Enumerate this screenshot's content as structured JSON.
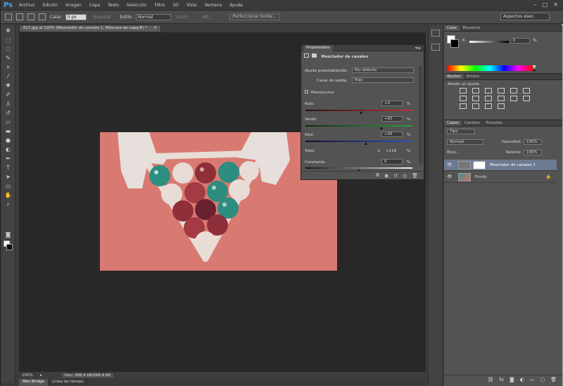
{
  "app": {
    "logo": "Ps"
  },
  "menu": [
    "Archivo",
    "Edición",
    "Imagen",
    "Capa",
    "Texto",
    "Selección",
    "Filtro",
    "3D",
    "Vista",
    "Ventana",
    "Ayuda"
  ],
  "window_controls": [
    "–",
    "□",
    "✕"
  ],
  "options": {
    "feather_label": "Calar:",
    "feather_value": "0 px",
    "antialias_label": "Suavizar",
    "style_label": "Estilo:",
    "style_value": "Normal",
    "width_label": "Anch.:",
    "height_label": "Alt.:",
    "refine_button": "Perfeccionar borde...",
    "workspace": "Aspectos esen."
  },
  "document": {
    "tab_title": "617.jpg al 100% (Mezclador de canales 1, Máscara de capa/8) *",
    "zoom": "100%",
    "doc_info": "Doc: 388,4 kB/388,4 kB"
  },
  "bottom_tabs": [
    "Mini Bridge",
    "Línea de tiempo"
  ],
  "properties": {
    "tab": "Propiedades",
    "title": "Mezclador de canales",
    "preset_label": "Ajuste preestablecido:",
    "preset_value": "Por defecto",
    "channel_label": "Canal de salida:",
    "channel_value": "Rojo",
    "mono_label": "Monocromo",
    "rows": [
      {
        "label": "Rojo:",
        "value": "+9",
        "unit": "%"
      },
      {
        "label": "Verde:",
        "value": "+83",
        "unit": "%"
      },
      {
        "label": "Azul:",
        "value": "+26",
        "unit": "%"
      },
      {
        "label": "Total:",
        "value": "+118",
        "unit": "%"
      },
      {
        "label": "Constante:",
        "value": "0",
        "unit": "%"
      }
    ],
    "slider_levels_pct": [
      9,
      83,
      26,
      0
    ]
  },
  "color_panel": {
    "tabs": [
      "Color",
      "Muestras"
    ],
    "slider_value": "0"
  },
  "adjust_panel": {
    "tabs": [
      "Ajustes",
      "Estilos"
    ],
    "heading": "Añadir un ajuste"
  },
  "layers_panel": {
    "tabs": [
      "Capas",
      "Canales",
      "Trazados"
    ],
    "kind": "Tipo",
    "blend_mode": "Normal",
    "opacity_label": "Opacidad:",
    "opacity_value": "100%",
    "lock_label": "Bloq.:",
    "fill_label": "Relleno:",
    "fill_value": "100%",
    "layers": [
      {
        "name": "Mezclador de canales 1",
        "selected": true
      },
      {
        "name": "Fondo",
        "selected": false
      }
    ]
  },
  "colors": {
    "image_tint": "#d97a72",
    "red_slider": "#c03030",
    "green_slider": "#30a040",
    "blue_slider": "#3050c0",
    "selection": "#6d7b92"
  }
}
